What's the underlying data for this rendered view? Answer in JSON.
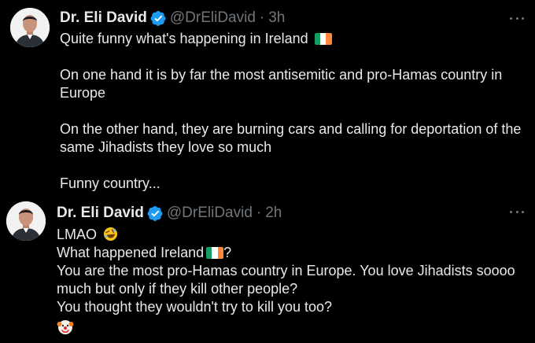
{
  "colors": {
    "background": "#000000",
    "text_primary": "#e7e9ea",
    "text_secondary": "#71767b",
    "verified_badge": "#1d9bf0",
    "flag_green": "#169b62",
    "flag_white": "#ffffff",
    "flag_orange": "#ff883e"
  },
  "tweets": [
    {
      "author": {
        "display_name": "Dr. Eli David",
        "handle": "@DrEliDavid",
        "verified_icon": "verified-badge-icon",
        "avatar": "profile-photo"
      },
      "separator": "·",
      "time": "3h",
      "more_icon": "more-options-icon",
      "lines": {
        "line1": "Quite funny what's happening in Ireland",
        "para2": "On one hand it is by far the most antisemitic and pro-Hamas country in Europe",
        "para3": "On the other hand, they are burning cars and calling for deportation of the same Jihadists they love so much",
        "para4": "Funny country..."
      },
      "emojis": [
        "ireland-flag-icon"
      ]
    },
    {
      "author": {
        "display_name": "Dr. Eli David",
        "handle": "@DrEliDavid",
        "verified_icon": "verified-badge-icon",
        "avatar": "profile-photo"
      },
      "separator": "·",
      "time": "2h",
      "more_icon": "more-options-icon",
      "lines": {
        "line1": "LMAO",
        "line2a": "What happened Ireland",
        "line2b": "?",
        "line3": "You are the most pro-Hamas country in Europe. You love Jihadists soooo much but only if they kill other people?",
        "line4": "You thought they wouldn't try to kill you too?"
      },
      "emojis": [
        "rolling-laughing-icon",
        "ireland-flag-icon",
        "clown-face-icon"
      ]
    }
  ]
}
